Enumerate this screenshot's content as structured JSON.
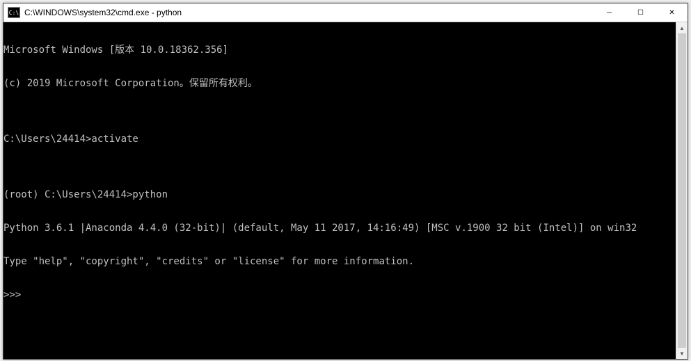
{
  "window": {
    "icon_text": "C:\\",
    "title": "C:\\WINDOWS\\system32\\cmd.exe - python"
  },
  "controls": {
    "minimize": "─",
    "maximize": "☐",
    "close": "✕"
  },
  "terminal": {
    "lines": [
      "Microsoft Windows [版本 10.0.18362.356]",
      "(c) 2019 Microsoft Corporation。保留所有权利。",
      "",
      "C:\\Users\\24414>activate",
      "",
      "(root) C:\\Users\\24414>python",
      "Python 3.6.1 |Anaconda 4.4.0 (32-bit)| (default, May 11 2017, 14:16:49) [MSC v.1900 32 bit (Intel)] on win32",
      "Type \"help\", \"copyright\", \"credits\" or \"license\" for more information.",
      ">>>"
    ]
  },
  "scrollbar": {
    "up": "▲",
    "down": "▼"
  }
}
